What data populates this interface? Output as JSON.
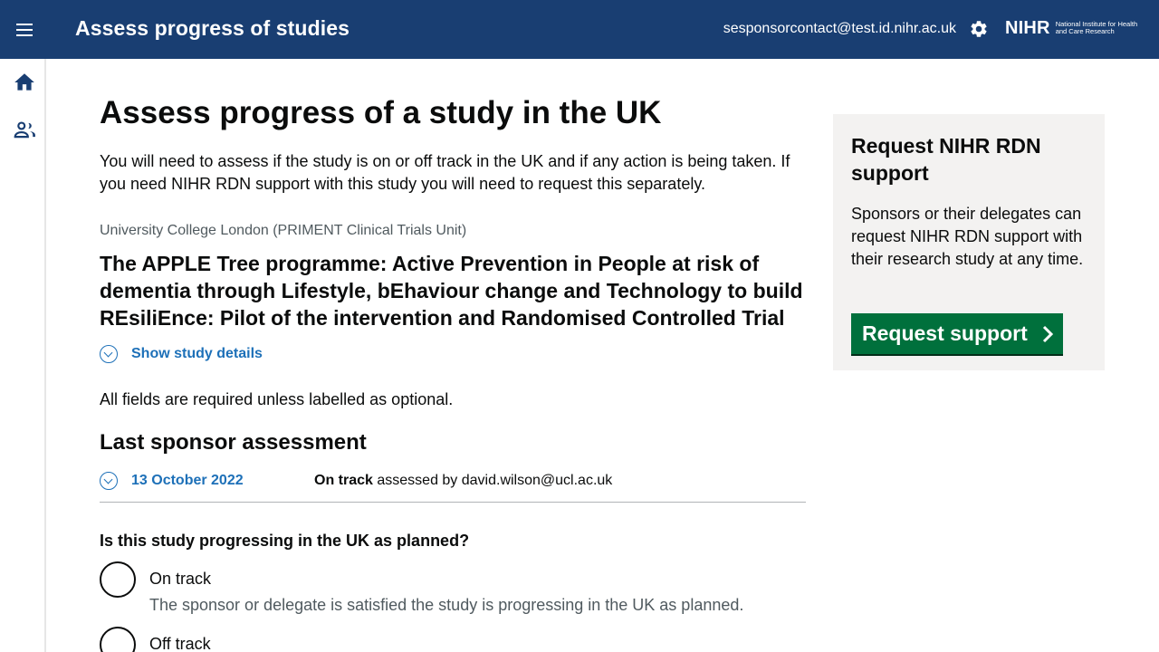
{
  "header": {
    "app_title": "Assess progress of studies",
    "user_email": "sesponsorcontact@test.id.nihr.ac.uk",
    "logo_word": "NIHR",
    "logo_subtitle": "National Institute for Health and Care Research",
    "brand_color": "#193e72"
  },
  "side_rail": {
    "icons": [
      "home-icon",
      "people-icon"
    ]
  },
  "main": {
    "page_title": "Assess progress of a study in the UK",
    "intro": "You will need to assess if the study is on or off track in the UK and if any action is being taken. If you need NIHR RDN support with this study you will need to request this separately.",
    "organisation": "University College London (PRIMENT Clinical Trials Unit)",
    "study_title": "The APPLE Tree programme: Active Prevention in People at risk of dementia through Lifestyle, bEhaviour change and Technology to build REsiliEnce: Pilot of the intervention and Randomised Controlled Trial",
    "details_toggle": "Show study details",
    "fields_note": "All fields are required unless labelled as optional.",
    "last_assessment": {
      "heading": "Last sponsor assessment",
      "date": "13 October 2022",
      "status": "On track",
      "assessed_by_text": " assessed by david.wilson@ucl.ac.uk"
    },
    "question": "Is this study progressing in the UK as planned?",
    "options": [
      {
        "label": "On track",
        "hint": "The sponsor or delegate is satisfied the study is progressing in the UK as planned."
      },
      {
        "label": "Off track"
      }
    ]
  },
  "aside": {
    "title": "Request NIHR RDN support",
    "text": "Sponsors or their delegates can request NIHR RDN support with their research study at any time.",
    "button_label": "Request support",
    "button_color": "#00703c"
  }
}
